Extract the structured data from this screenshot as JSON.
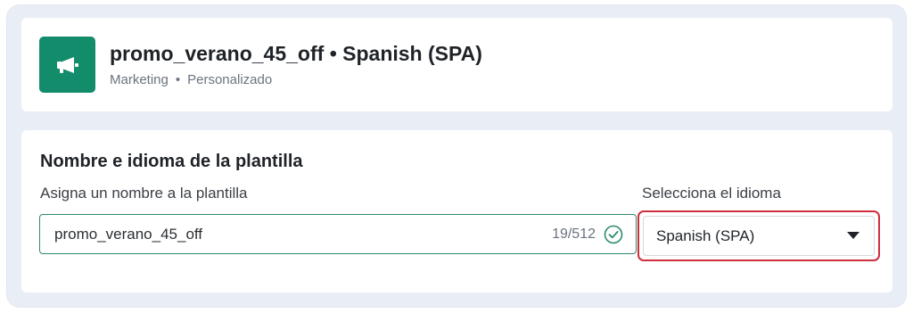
{
  "colors": {
    "brand": "#128c6b",
    "input_border": "#2e8a6c",
    "highlight": "#cf2e3d"
  },
  "header": {
    "logo_icon": "megaphone-icon",
    "title": "promo_verano_45_off • Spanish (SPA)",
    "category": "Marketing",
    "separator": "•",
    "type": "Personalizado"
  },
  "form": {
    "section_title": "Nombre e idioma de la plantilla",
    "name_label": "Asigna un nombre a la plantilla",
    "name_value": "promo_verano_45_off",
    "name_counter": "19/512",
    "name_status_icon": "check-circle-icon",
    "language_label": "Selecciona el idioma",
    "language_value": "Spanish (SPA)",
    "language_dropdown_icon": "caret-down-icon"
  }
}
